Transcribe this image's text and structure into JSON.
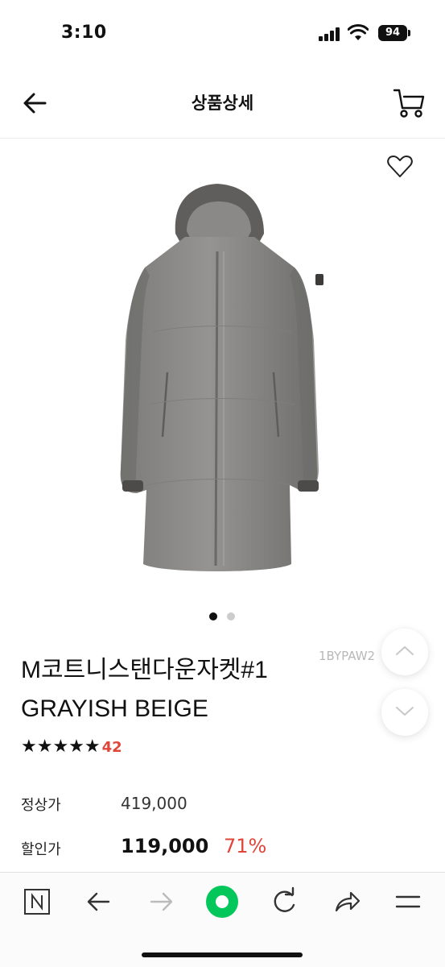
{
  "status": {
    "time": "3:10",
    "battery": "94"
  },
  "header": {
    "title": "상품상세"
  },
  "product": {
    "name": "M코트니스탠다운자켓#1 GRAYISH BEIGE",
    "code": "1BYPAW2",
    "rating": "★★★★★",
    "review_count": "42",
    "image_page": 1,
    "image_total": 2
  },
  "prices": {
    "regular_label": "정상가",
    "regular_value": "419,000",
    "sale_label": "할인가",
    "sale_value": "119,000",
    "discount": "71%"
  },
  "icons": {
    "back": "arrow-left-icon",
    "cart": "cart-icon",
    "wish": "heart-icon",
    "scroll_up": "chevron-up-icon",
    "scroll_down": "chevron-down-icon"
  },
  "colors": {
    "accent_red": "#e0453a",
    "naver_green": "#03c75a",
    "coat_gray": "#8a8987"
  }
}
